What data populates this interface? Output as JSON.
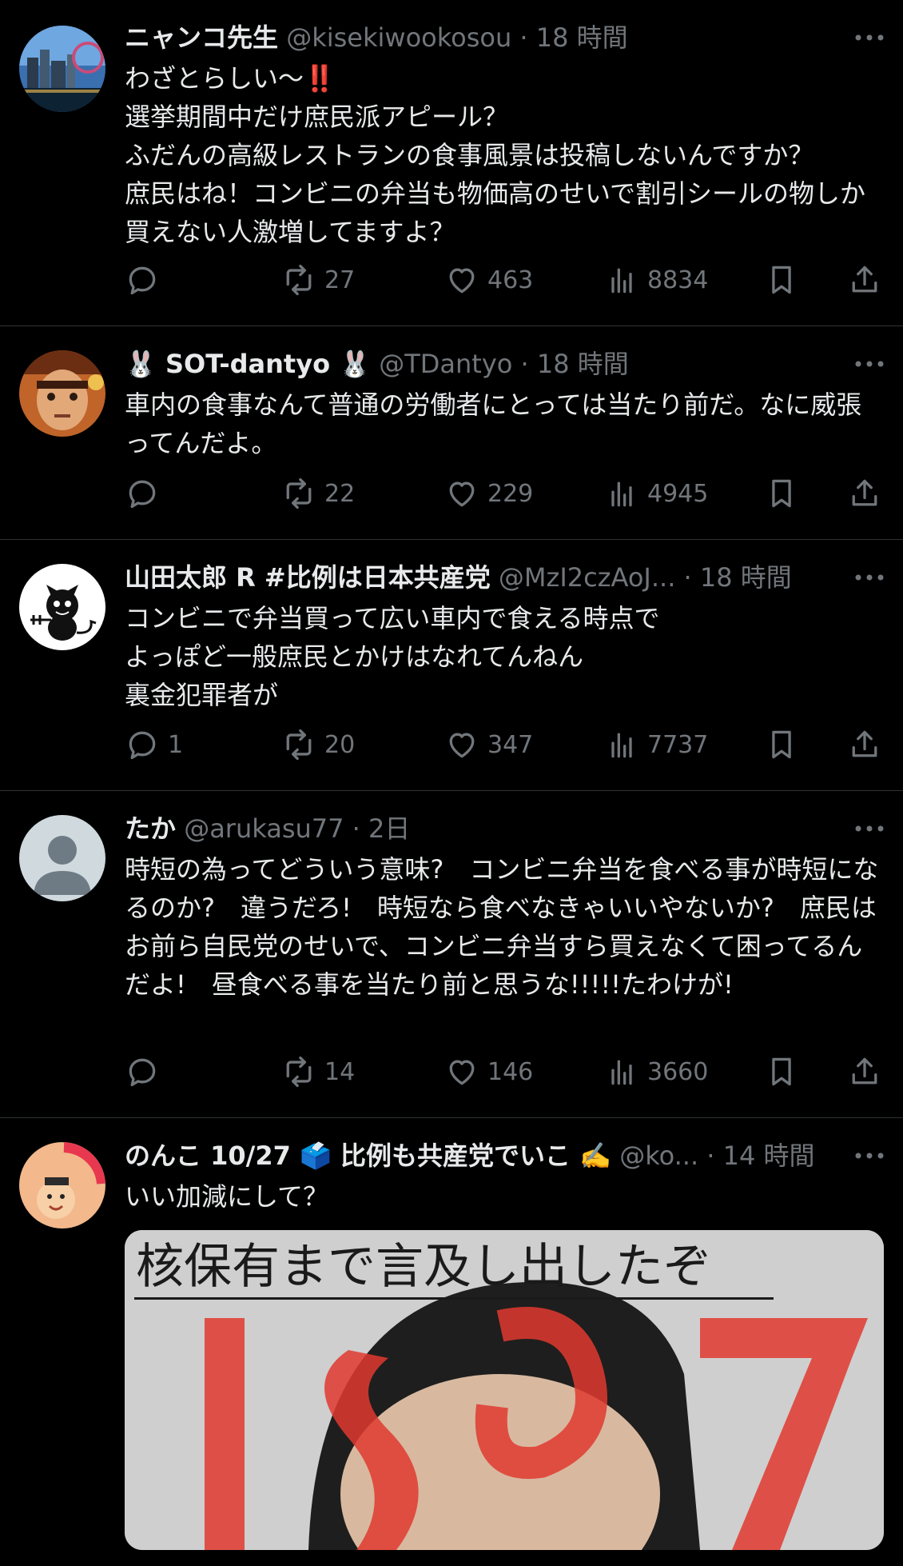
{
  "colors": {
    "background": "#000000",
    "text": "#e7e9ea",
    "muted": "#71767b",
    "divider": "#2f3336"
  },
  "tweets": [
    {
      "name": "ニャンコ先生",
      "handle": "@kisekiwookosou",
      "separator": "·",
      "time": "18 時間",
      "text": "わざとらしい〜‼️\n選挙期間中だけ庶民派アピール？\nふだんの高級レストランの食事風景は投稿しないんですか？\n庶民はね！コンビニの弁当も物価高のせいで割引シールの物しか買えない人激増してますよ？",
      "replies": "",
      "retweets": "27",
      "likes": "463",
      "views": "8834"
    },
    {
      "name": "🐰 SOT-dantyo 🐰",
      "handle": "@TDantyo",
      "separator": "·",
      "time": "18 時間",
      "text": "車内の食事なんて普通の労働者にとっては当たり前だ。なに威張ってんだよ。",
      "replies": "",
      "retweets": "22",
      "likes": "229",
      "views": "4945"
    },
    {
      "name": "山田太郎 R #比例は日本共産党",
      "handle": "@MzI2czAoJ...",
      "separator": "·",
      "time": "18 時間",
      "text": "コンビニで弁当買って広い車内で食える時点で\nよっぽど一般庶民とかけはなれてんねん\n裏金犯罪者が",
      "replies": "1",
      "retweets": "20",
      "likes": "347",
      "views": "7737"
    },
    {
      "name": "たか",
      "handle": "@arukasu77",
      "separator": "·",
      "time": "2日",
      "text": "時短の為ってどういう意味?　コンビニ弁当を食べる事が時短になるのか?　違うだろ!　時短なら食べなきゃいいやないか?　庶民はお前ら自民党のせいで、コンビニ弁当すら買えなくて困ってるんだよ!　昼食べる事を当たり前と思うな!!!!!たわけが!",
      "replies": "",
      "retweets": "14",
      "likes": "146",
      "views": "3660"
    },
    {
      "name": "のんこ 10/27 🗳️ 比例も共産党でいこ ✍️",
      "handle": "@ko...",
      "separator": "·",
      "time": "14 時間",
      "text": "いい加減にして？",
      "media_caption": "核保有まで言及し出したぞ"
    }
  ]
}
